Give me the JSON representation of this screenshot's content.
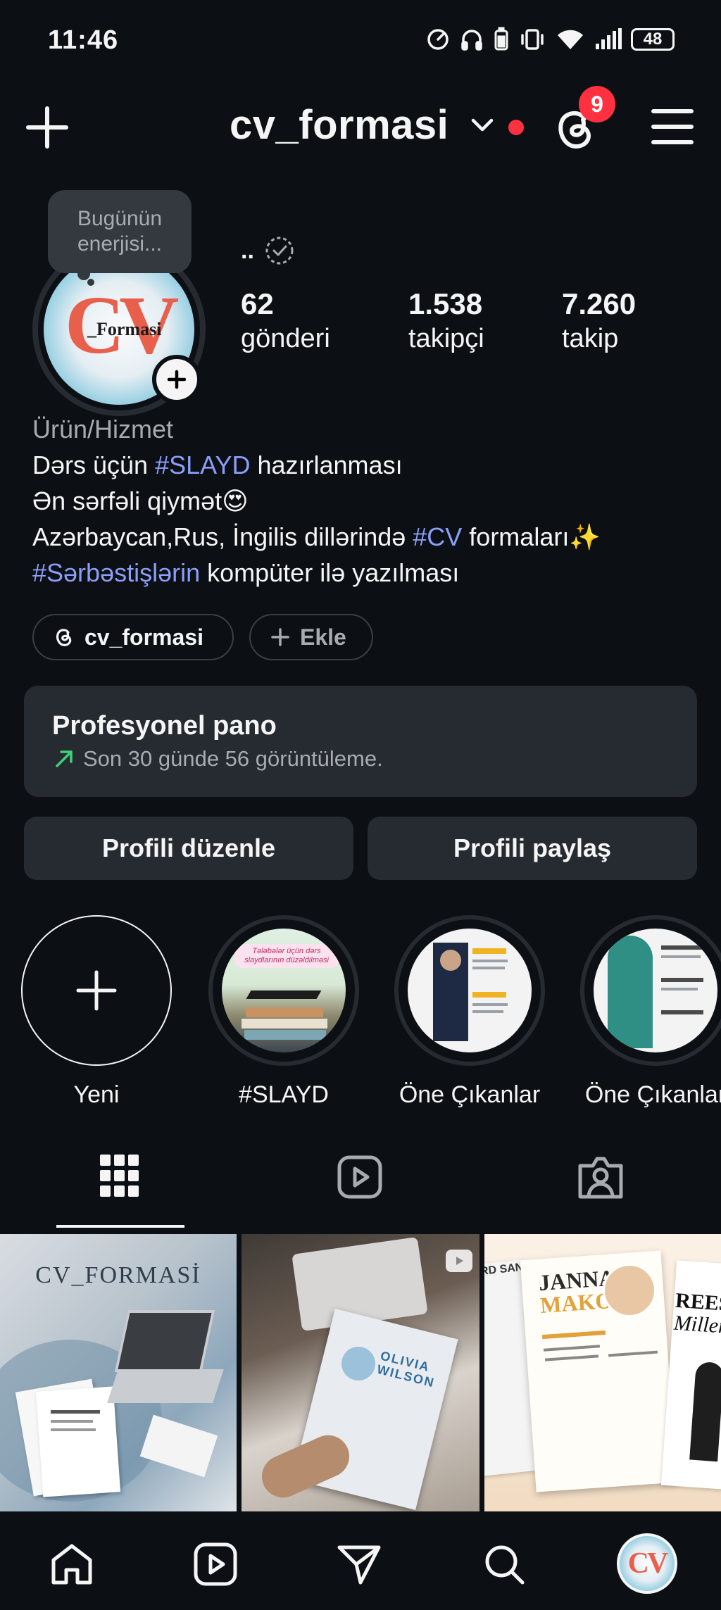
{
  "status_bar": {
    "time": "11:46",
    "battery": "48"
  },
  "header": {
    "username": "cv_formasi",
    "notification_count": "9"
  },
  "profile": {
    "note": "Bugünün enerjisi...",
    "avatar_text": "CV",
    "avatar_subtext": "_Formasi",
    "display_name": "..",
    "stats": [
      {
        "value": "62",
        "label": "gönderi"
      },
      {
        "value": "1.538",
        "label": "takipçi"
      },
      {
        "value": "7.260",
        "label": "takip"
      }
    ],
    "category": "Ürün/Hizmet",
    "bio": {
      "line1_pre": "Dərs üçün ",
      "line1_tag": "#SLAYD",
      "line1_post": " hazırlanması",
      "line2": "Ən sərfəli qiymət😍",
      "line3_pre": "Azərbaycan,Rus, İngilis dillərində ",
      "line3_tag": "#CV",
      "line3_post": " formaları✨",
      "line4_tag": "#Sərbəstişlərin",
      "line4_post": " kompüter ilə yazılması"
    },
    "threads_chip": "cv_formasi",
    "add_chip": "Ekle"
  },
  "dashboard": {
    "title": "Profesyonel pano",
    "subtitle": "Son 30 günde 56 görüntüleme."
  },
  "buttons": {
    "edit": "Profili düzenle",
    "share": "Profili paylaş"
  },
  "highlights": [
    {
      "label": "Yeni"
    },
    {
      "label": "#SLAYD",
      "inner_text": "Tələbələr üçün dərs slaydlarının düzəldilməsi"
    },
    {
      "label": "Öne Çıkanlar"
    },
    {
      "label": "Öne Çıkanlar"
    }
  ],
  "grid": [
    {
      "title": "CV_FORMASİ"
    },
    {
      "name_line1": "OLIVIA",
      "name_line2": "WILSON"
    },
    {
      "name_line1": "JANNA",
      "name_line2": "MAKOVA",
      "side_left": "RD SANCHE",
      "side_right": "REESE",
      "side_right2": "Miller"
    }
  ],
  "icons": {
    "new_post": "plus-icon",
    "threads": "threads-icon",
    "menu": "hamburger-menu-icon",
    "grid_tab": "grid-icon",
    "reels_tab": "reels-icon",
    "tagged_tab": "tagged-icon",
    "home": "home-icon",
    "reels": "reels-icon",
    "direct": "send-icon",
    "search": "search-icon"
  },
  "colors": {
    "background": "#0c1014",
    "card": "#262b31",
    "hashtag": "#8c9ef8",
    "notification": "#ff3040",
    "trend_up": "#3fd17a"
  }
}
